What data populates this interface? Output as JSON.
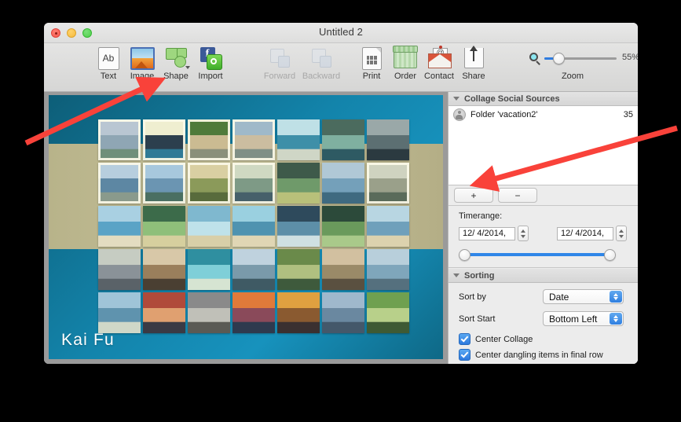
{
  "window": {
    "title": "Untitled 2",
    "traffic_lights": [
      "close",
      "minimize",
      "maximize"
    ]
  },
  "toolbar": {
    "items": [
      {
        "label": "Text",
        "icon": "text-icon",
        "enabled": true
      },
      {
        "label": "Image",
        "icon": "image-icon",
        "enabled": true
      },
      {
        "label": "Shape",
        "icon": "shape-icon",
        "enabled": true
      },
      {
        "label": "Import",
        "icon": "import-icon",
        "enabled": true
      },
      {
        "label": "Forward",
        "icon": "forward-icon",
        "enabled": false
      },
      {
        "label": "Backward",
        "icon": "backward-icon",
        "enabled": false
      },
      {
        "label": "Print",
        "icon": "print-icon",
        "enabled": true
      },
      {
        "label": "Order",
        "icon": "order-icon",
        "enabled": true
      },
      {
        "label": "Contact",
        "icon": "contact-icon",
        "enabled": true
      },
      {
        "label": "Share",
        "icon": "share-icon",
        "enabled": true
      }
    ],
    "zoom": {
      "label": "Zoom",
      "value": "55%",
      "percent": 55,
      "icon": "magnifier-icon"
    },
    "overflow": "»"
  },
  "canvas": {
    "title_text": "Kai Fu",
    "background_color": "#1384ab",
    "band_color": "#c0bb93",
    "grid_columns": 7,
    "grid_rows": 5,
    "photo_count": 35
  },
  "sidebar": {
    "sources_panel": {
      "header": "Collage Social Sources",
      "rows": [
        {
          "icon": "folder-user-icon",
          "name": "Folder 'vacation2'",
          "count": "35"
        }
      ],
      "add_button": "+",
      "remove_button": "−"
    },
    "timerange": {
      "label": "Timerange:",
      "start_value": "12/  4/2014,",
      "end_value": "12/  4/2014,",
      "slider_low_percent": 0,
      "slider_high_percent": 100
    },
    "sorting_panel": {
      "header": "Sorting",
      "sort_by_label": "Sort by",
      "sort_by_value": "Date",
      "sort_start_label": "Sort Start",
      "sort_start_value": "Bottom Left",
      "checkboxes": [
        {
          "label": "Center Collage",
          "checked": true
        },
        {
          "label": "Center dangling items in final row",
          "checked": true
        }
      ]
    }
  },
  "annotations": {
    "arrow_color": "#f9423a",
    "arrows": [
      {
        "name": "arrow-to-shape-import",
        "from": [
          33,
          182
        ],
        "to": [
          196,
          105
        ]
      },
      {
        "name": "arrow-to-add-source",
        "from": [
          862,
          163
        ],
        "to": [
          614,
          232
        ]
      }
    ]
  }
}
